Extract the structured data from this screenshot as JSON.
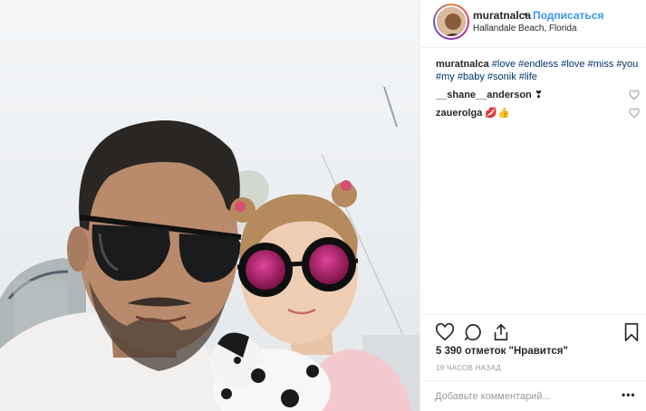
{
  "post": {
    "username": "muratnalca",
    "follow_separator": "•",
    "follow_label": "Подписаться",
    "location": "Hallandale Beach, Florida",
    "photo_description": "selfie of a man and a girl wearing sunglasses holding a dalmatian toy"
  },
  "caption": {
    "username": "muratnalca",
    "hashtags": [
      "#love",
      "#endless",
      "#love",
      "#miss",
      "#you",
      "#my",
      "#baby",
      "#sonik",
      "#life"
    ]
  },
  "comments": [
    {
      "username": "__shane__anderson",
      "text": "❣"
    },
    {
      "username": "zauerolga",
      "text": "💋👍"
    }
  ],
  "actions": {
    "like_icon": "heart-icon",
    "comment_icon": "comment-bubble-icon",
    "share_icon": "share-icon",
    "save_icon": "bookmark-icon"
  },
  "likes_label": "5 390 отметок \"Нравится\"",
  "time_label": "19 ЧАСОВ НАЗАД",
  "comment_box": {
    "placeholder": "Добавьте комментарий...",
    "more_label": "•••"
  },
  "colors": {
    "link_blue": "#3897f0",
    "hashtag_blue": "#003569",
    "text": "#262626",
    "muted": "#999999",
    "border": "#efefef"
  }
}
